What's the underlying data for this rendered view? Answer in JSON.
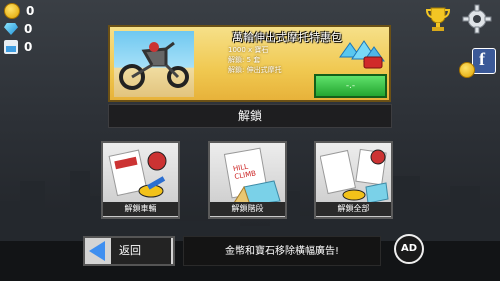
{
  "currency": {
    "coins": "0",
    "gems": "0",
    "fuel": "0"
  },
  "offer": {
    "title": "萬輪伸出式摩托特惠包",
    "lines": [
      "1000 x 寶石",
      "解鎖: 5 套",
      "解鎖: 伸出式摩托"
    ],
    "buy_label": "-.-"
  },
  "unlock_header": "解鎖",
  "cards": [
    {
      "label": "解鎖車輛",
      "book_text": "HILL CLIMB"
    },
    {
      "label": "解鎖階段",
      "book_text": "HILL CLIMB RACING"
    },
    {
      "label": "解鎖全部",
      "book_text": ""
    }
  ],
  "back_label": "返回",
  "ad_message": "金幣和寶石移除橫幅廣告!",
  "ad_badge": "AD",
  "colors": {
    "offer_bg": "#f0c850",
    "buy_green": "#2fb93a",
    "back_arrow": "#3f8ff0"
  }
}
